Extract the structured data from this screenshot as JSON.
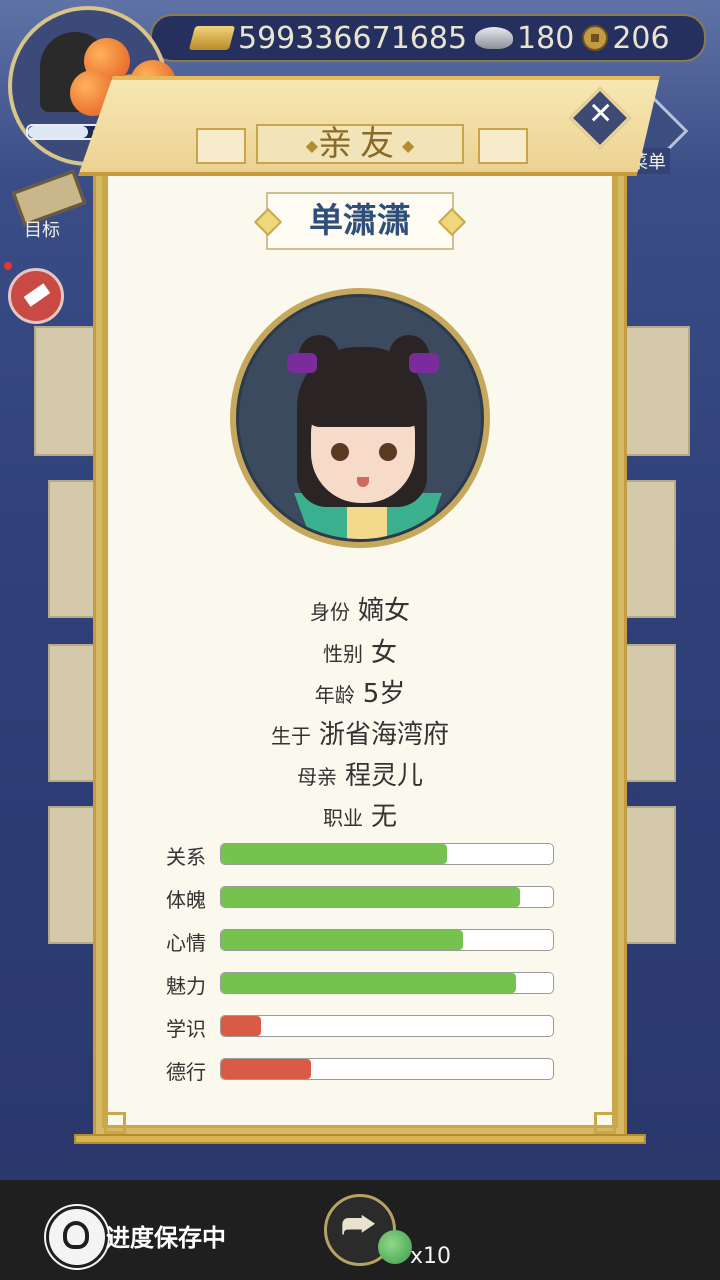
{
  "topbar": {
    "gold": "599336671685",
    "silver": "180",
    "coins": "206"
  },
  "player": {
    "name_partial": "程灵儿"
  },
  "side": {
    "goal_label": "目标",
    "menu_label": "菜单"
  },
  "dialog": {
    "title": "亲友",
    "name": "单潇潇",
    "info": [
      {
        "key": "身份",
        "value": "嫡女"
      },
      {
        "key": "性别",
        "value": "女"
      },
      {
        "key": "年龄",
        "value": "5岁"
      },
      {
        "key": "生于",
        "value": "浙省海湾府"
      },
      {
        "key": "母亲",
        "value": "程灵儿"
      },
      {
        "key": "职业",
        "value": "无"
      }
    ],
    "stats": [
      {
        "label": "关系",
        "value": 0.68,
        "color": "#76c24f"
      },
      {
        "label": "体魄",
        "value": 0.9,
        "color": "#76c24f"
      },
      {
        "label": "心情",
        "value": 0.73,
        "color": "#76c24f"
      },
      {
        "label": "魅力",
        "value": 0.89,
        "color": "#76c24f"
      },
      {
        "label": "学识",
        "value": 0.12,
        "color": "#db5a45"
      },
      {
        "label": "德行",
        "value": 0.27,
        "color": "#db5a45"
      }
    ]
  },
  "bottom": {
    "save_status": "进度保存中",
    "multiplier": "x10"
  },
  "icons": [
    "gold-ingot-icon",
    "silver-ingot-icon",
    "copper-coin-icon",
    "close-icon",
    "share-icon",
    "dragon-save-icon",
    "mascot-icon",
    "scroll-icon",
    "broom-icon",
    "menu-dots-icon"
  ]
}
